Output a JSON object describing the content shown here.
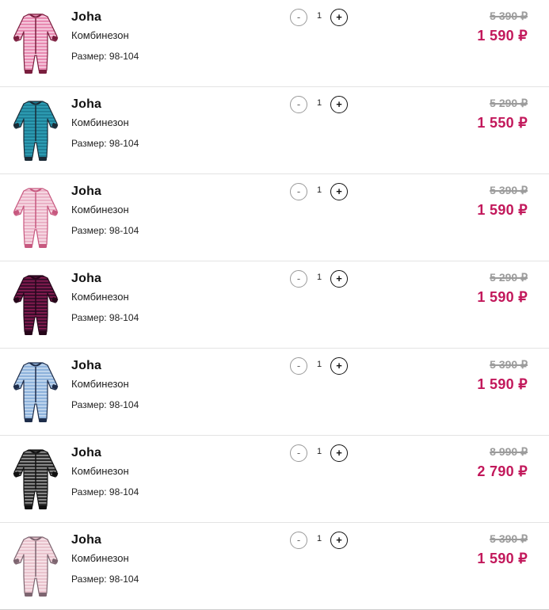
{
  "cart": {
    "items": [
      {
        "brand": "Joha",
        "type": "Комбинезон",
        "size": "Размер: 98-104",
        "quantity": "1",
        "old_price": "5 390 ₽",
        "new_price": "1 590 ₽",
        "image": "pink-striped-romper",
        "colors": {
          "base": "#e88bb2",
          "stripe": "#f7d3e3",
          "trim": "#7a1e3e"
        }
      },
      {
        "brand": "Joha",
        "type": "Комбинезон",
        "size": "Размер: 98-104",
        "quantity": "1",
        "old_price": "5 290 ₽",
        "new_price": "1 550 ₽",
        "image": "teal-striped-romper",
        "colors": {
          "base": "#1f7f96",
          "stripe": "#2fa1b8",
          "trim": "#1b2b36"
        }
      },
      {
        "brand": "Joha",
        "type": "Комбинезон",
        "size": "Размер: 98-104",
        "quantity": "1",
        "old_price": "5 390 ₽",
        "new_price": "1 590 ₽",
        "image": "light-pink-print-romper",
        "colors": {
          "base": "#f5d6e1",
          "stripe": "#e8a9c0",
          "trim": "#c7587f"
        }
      },
      {
        "brand": "Joha",
        "type": "Комбинезон",
        "size": "Размер: 98-104",
        "quantity": "1",
        "old_price": "5 290 ₽",
        "new_price": "1 590 ₽",
        "image": "dark-purple-striped-romper",
        "colors": {
          "base": "#3b0d2c",
          "stripe": "#8a1c52",
          "trim": "#250619"
        }
      },
      {
        "brand": "Joha",
        "type": "Комбинезон",
        "size": "Размер: 98-104",
        "quantity": "1",
        "old_price": "5 390 ₽",
        "new_price": "1 590 ₽",
        "image": "light-blue-striped-romper",
        "colors": {
          "base": "#8fb3dc",
          "stripe": "#c9dcf0",
          "trim": "#1e2d4a"
        }
      },
      {
        "brand": "Joha",
        "type": "Комбинезон",
        "size": "Размер: 98-104",
        "quantity": "1",
        "old_price": "8 990 ₽",
        "new_price": "2 790 ₽",
        "image": "black-grey-striped-romper",
        "colors": {
          "base": "#2a2a2a",
          "stripe": "#9a9a9a",
          "trim": "#111111"
        }
      },
      {
        "brand": "Joha",
        "type": "Комбинезон",
        "size": "Размер: 98-104",
        "quantity": "1",
        "old_price": "5 390 ₽",
        "new_price": "1 590 ₽",
        "image": "pale-pink-striped-romper",
        "colors": {
          "base": "#e9c3cd",
          "stripe": "#f8e6eb",
          "trim": "#7d6570"
        }
      }
    ],
    "controls": {
      "minus_label": "-",
      "plus_label": "+"
    }
  }
}
